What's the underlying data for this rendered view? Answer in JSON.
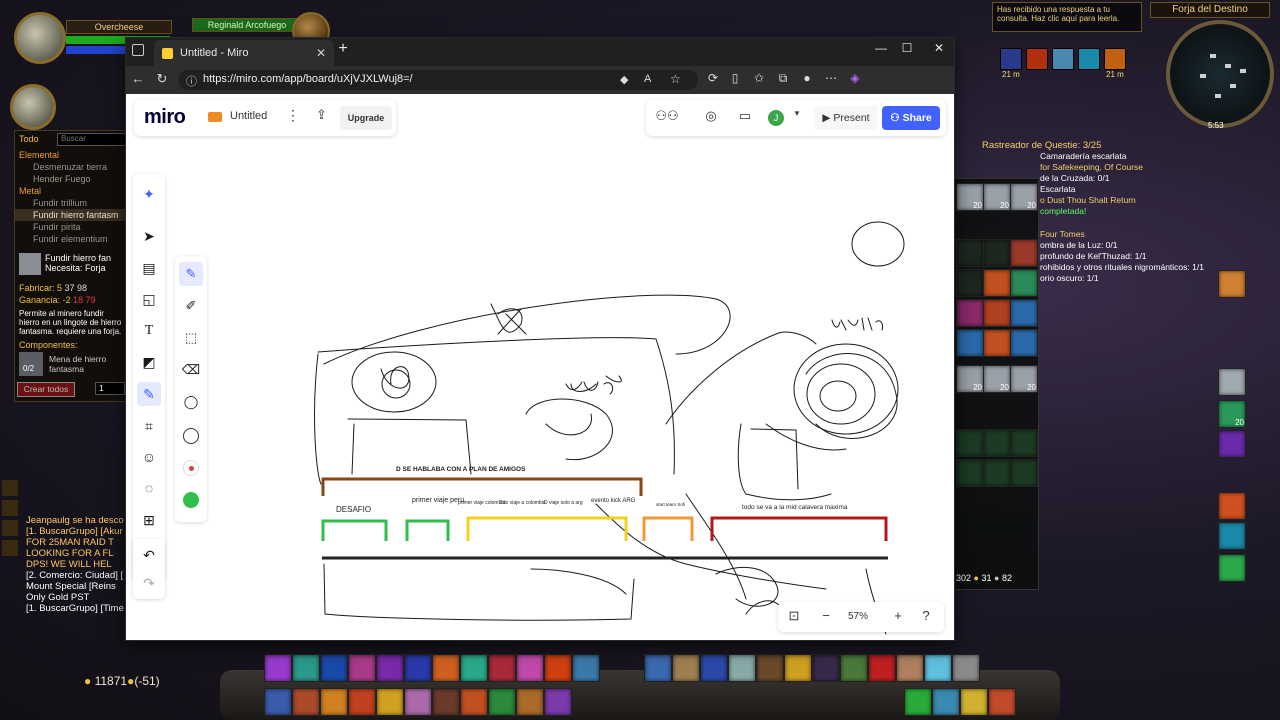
{
  "game": {
    "player_name": "Overcheese",
    "target_name": "Reginald Arcofuego",
    "zone": "Forja del Destino",
    "bnet_toast": "Has recibido una respuesta a tu consulta. Haz clic aquí para leerla.",
    "minimap_time": "5:53",
    "buff_time_1": "21 m",
    "buff_time_2": "21 m",
    "gold_display": "11871",
    "gold_change": "(-51)",
    "profession": {
      "filter_label": "Todo",
      "search_placeholder": "Buscar",
      "categories": [
        {
          "name": "Elemental",
          "items": [
            "Desmenuzar tierra",
            "Hender Fuego"
          ]
        },
        {
          "name": "Metal",
          "items": [
            "Fundir trillium",
            "Fundir hierro fantasm",
            "Fundir pirita",
            "Fundir elementium"
          ]
        }
      ],
      "selected_item": "Fundir hierro fan",
      "selected_requires": "Necesita:  Forja",
      "craft_label": "Fabricar: 5",
      "craft_prices": "37   98",
      "profit_label": "Ganancia: -2",
      "profit_prices": "18   79",
      "description": "Permite al minero fundir hierro en un lingote de hierro fantasma. requiere una forja.",
      "components_label": "Componentes:",
      "component_name": "Mena de hierro fantasma",
      "component_count": "0/2",
      "craft_all_button": "Crear todos",
      "quantity": "1"
    },
    "chat_lines": [
      "Jeanpaulg se ha desco",
      "[1. BuscarGrupo] [Akur",
      "FOR 25MAN RAID T",
      "LOOKING FOR A FL",
      "DPS!  WE WILL HEL",
      "[2. Comercio: Ciudad] [",
      "Mount Special [Reins",
      "Only Gold PST",
      "[1. BuscarGrupo] [Time"
    ],
    "quest_tracker": {
      "header": "Rastreador de Questie: 3/25",
      "lines": [
        "Camaradería escarlata",
        "for Safekeeping, Of Course",
        "de la Cruzada: 0/1",
        "Escarlata",
        "o Dust Thou Shalt Return",
        "completada!",
        "Four Tomes",
        "ombra de la Luz: 0/1",
        "profundo de Kel'Thuzad: 1/1",
        "rohibidos y otros rituales nigrománticos: 1/1",
        "orio oscuro: 1/1"
      ]
    },
    "bag_counts": [
      "20",
      "20",
      "20",
      "20",
      "20",
      "20"
    ],
    "bag_footer": [
      "302",
      "31",
      "82"
    ],
    "right_counts": [
      "20"
    ]
  },
  "browser": {
    "tab_title": "Untitled - Miro",
    "url": "https://miro.com/app/board/uXjVJXLWuj8=/",
    "icons": [
      "back-icon",
      "reload-icon",
      "info-icon"
    ]
  },
  "miro": {
    "logo": "miro",
    "board_name": "Untitled",
    "upgrade_label": "Upgrade",
    "avatar_initial": "J",
    "present_label": "Present",
    "share_label": "Share",
    "zoom_level": "57%",
    "colors": {
      "accent": "#4262ff",
      "pen_red": "#e53935",
      "pen_green": "#2fbf4a"
    }
  },
  "drawing": {
    "top_text": "D SE HABLABA  CON A PLAN DE AMIGOS",
    "labels": [
      "DESAFIO",
      "primer viaje peru",
      "primer viaje colombia",
      "2do viaje a colombia",
      "D viaje solo a arg",
      "evento kick ARG",
      "start team Sofi",
      "todo se va a la mid calavera maxima"
    ],
    "handwriting": [
      "1stnrct",
      "mayo"
    ]
  }
}
